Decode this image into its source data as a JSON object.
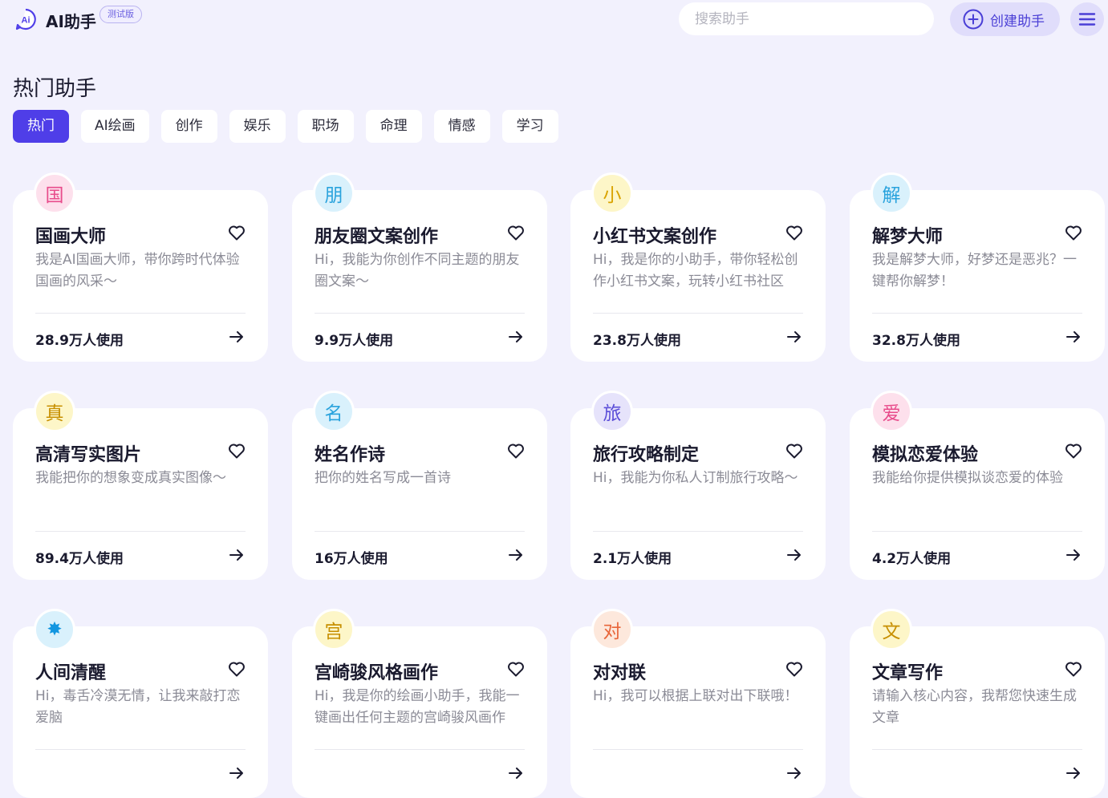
{
  "header": {
    "app_title": "AI助手",
    "beta_badge": "测试版",
    "search_placeholder": "搜索助手",
    "create_button": "创建助手",
    "accent_color": "#4f3ee8"
  },
  "section_title": "热门助手",
  "tabs": [
    "热门",
    "AI绘画",
    "创作",
    "娱乐",
    "职场",
    "命理",
    "情感",
    "学习"
  ],
  "active_tab": "热门",
  "cards": [
    {
      "icon": "国",
      "icon_bg": "#fde0ec",
      "icon_color": "#e84c8b",
      "title": "国画大师",
      "desc": "我是AI国画大师，带你跨时代体验国画的风采～",
      "usage": "28.9万人使用"
    },
    {
      "icon": "朋",
      "icon_bg": "#d9f1fc",
      "icon_color": "#2aa3dd",
      "title": "朋友圈文案创作",
      "desc": "Hi，我能为你创作不同主题的朋友圈文案～",
      "usage": "9.9万人使用"
    },
    {
      "icon": "小",
      "icon_bg": "#fdf6c8",
      "icon_color": "#d9a300",
      "title": "小红书文案创作",
      "desc": "Hi，我是你的小助手，带你轻松创作小红书文案，玩转小红书社区",
      "usage": "23.8万人使用"
    },
    {
      "icon": "解",
      "icon_bg": "#d9f1fc",
      "icon_color": "#2aa3dd",
      "title": "解梦大师",
      "desc": "我是解梦大师，好梦还是恶兆？一键帮你解梦！",
      "usage": "32.8万人使用"
    },
    {
      "icon": "真",
      "icon_bg": "#fdf6c8",
      "icon_color": "#c78f00",
      "title": "高清写实图片",
      "desc": "我能把你的想象变成真实图像～",
      "usage": "89.4万人使用"
    },
    {
      "icon": "名",
      "icon_bg": "#d9f1fc",
      "icon_color": "#2aa3dd",
      "title": "姓名作诗",
      "desc": "把你的姓名写成一首诗",
      "usage": "16万人使用"
    },
    {
      "icon": "旅",
      "icon_bg": "#e6e3fb",
      "icon_color": "#5b4ed8",
      "title": "旅行攻略制定",
      "desc": "Hi，我能为你私人订制旅行攻略～",
      "usage": "2.1万人使用"
    },
    {
      "icon": "爱",
      "icon_bg": "#fde0ec",
      "icon_color": "#e84c8b",
      "title": "模拟恋爱体验",
      "desc": "我能给你提供模拟谈恋爱的体验",
      "usage": "4.2万人使用"
    },
    {
      "icon": "✸",
      "icon_bg": "#d9f1fc",
      "icon_color": "#1296e0",
      "title": "人间清醒",
      "desc": "Hi，毒舌冷漠无情，让我来敲打恋爱脑",
      "usage": ""
    },
    {
      "icon": "宫",
      "icon_bg": "#fdf6c8",
      "icon_color": "#c78f00",
      "title": "宫崎骏风格画作",
      "desc": "Hi，我是你的绘画小助手，我能一键画出任何主题的宫崎骏风画作",
      "usage": ""
    },
    {
      "icon": "对",
      "icon_bg": "#fde8dc",
      "icon_color": "#e8663a",
      "title": "对对联",
      "desc": "Hi，我可以根据上联对出下联哦！",
      "usage": ""
    },
    {
      "icon": "文",
      "icon_bg": "#fdf6c8",
      "icon_color": "#c78f00",
      "title": "文章写作",
      "desc": "请输入核心内容，我帮您快速生成文章",
      "usage": ""
    }
  ]
}
